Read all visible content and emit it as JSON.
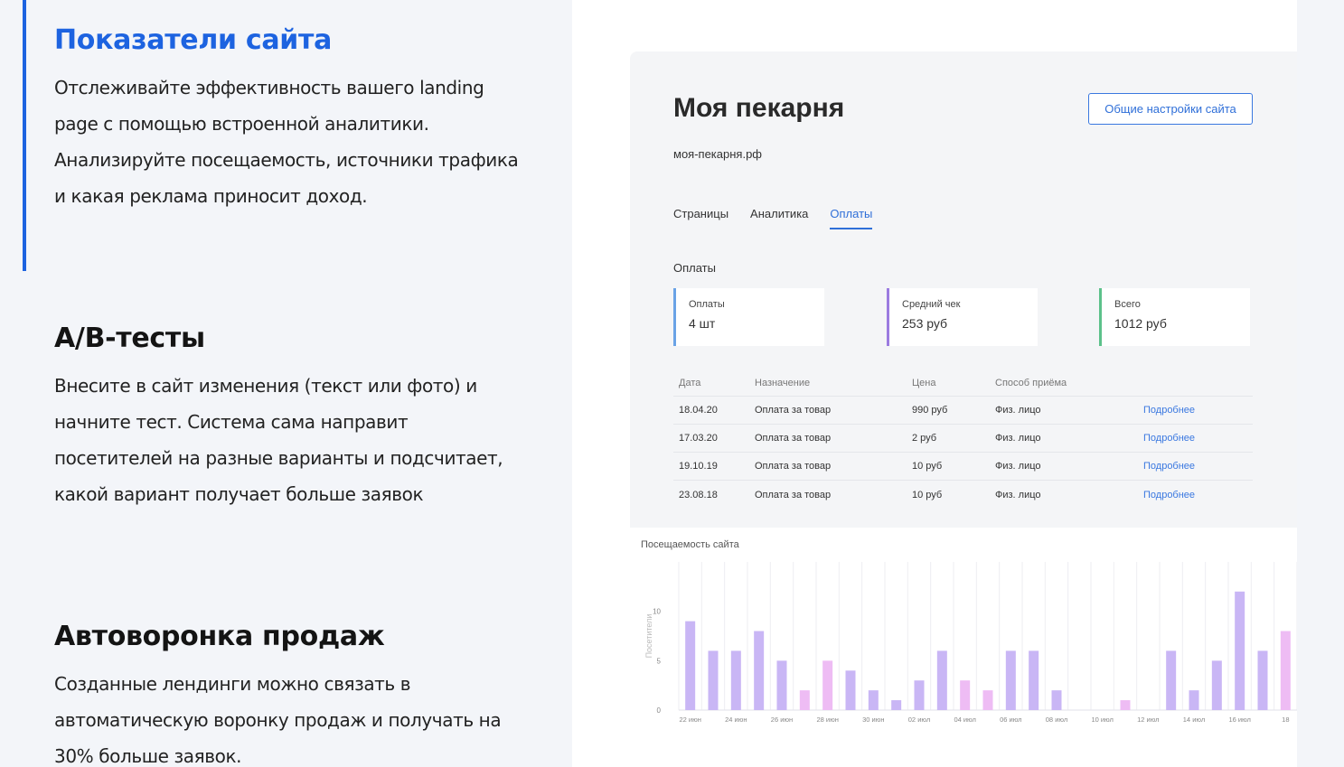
{
  "features": [
    {
      "title": "Показатели сайта",
      "text": "Отслеживайте эффективность вашего landing page с помощью встроенной аналитики. Анализируйте посещаемость, источники трафика и какая реклама приносит доход."
    },
    {
      "title": "A/B-тесты",
      "text": "Внесите в сайт изменения (текст или фото) и начните тест. Система сама направит посетителей на разные варианты и подсчитает, какой вариант получает больше заявок"
    },
    {
      "title": "Автоворонка продаж",
      "text": "Созданные лендинги можно связать в автоматическую воронку продаж и получать на 30% больше заявок."
    }
  ],
  "dashboard": {
    "site_title": "Моя пекарня",
    "site_url": "моя-пекарня.рф",
    "settings_button": "Общие настройки сайта",
    "tabs": [
      {
        "label": "Страницы",
        "active": false
      },
      {
        "label": "Аналитика",
        "active": false
      },
      {
        "label": "Оплаты",
        "active": true
      }
    ],
    "section_label": "Оплаты",
    "cards": [
      {
        "key": "Оплаты",
        "value": "4 шт"
      },
      {
        "key": "Средний чек",
        "value": "253 руб"
      },
      {
        "key": "Всего",
        "value": "1012 руб"
      }
    ],
    "table": {
      "headers": [
        "Дата",
        "Назначение",
        "Цена",
        "Способ приёма",
        ""
      ],
      "rows": [
        [
          "18.04.20",
          "Оплата за товар",
          "990 руб",
          "Физ. лицо",
          "Подробнее"
        ],
        [
          "17.03.20",
          "Оплата за товар",
          "2 руб",
          "Физ. лицо",
          "Подробнее"
        ],
        [
          "19.10.19",
          "Оплата за товар",
          "10 руб",
          "Физ. лицо",
          "Подробнее"
        ],
        [
          "23.08.18",
          "Оплата за товар",
          "10 руб",
          "Физ. лицо",
          "Подробнее"
        ]
      ]
    }
  },
  "colors": {
    "accent": "#1d63e0",
    "bar_purple": "#c9b6f5",
    "bar_pink": "#eebcf4"
  },
  "chart_data": {
    "type": "bar",
    "title": "Посещаемость сайта",
    "ylabel": "Посетители",
    "ylim": [
      0,
      15
    ],
    "yticks": [
      0,
      5,
      10
    ],
    "xticks": [
      "22 июн",
      "24 июн",
      "26 июн",
      "28 июн",
      "30 июн",
      "02 июл",
      "04 июл",
      "06 июл",
      "08 июл",
      "10 июл",
      "12 июл",
      "14 июл",
      "16 июл",
      "18"
    ],
    "values": [
      9,
      6,
      6,
      8,
      5,
      2,
      5,
      4,
      2,
      1,
      3,
      6,
      3,
      2,
      6,
      6,
      2,
      0,
      0,
      1,
      0,
      6,
      2,
      5,
      12,
      6,
      8
    ],
    "highlight": [
      false,
      false,
      false,
      false,
      false,
      true,
      true,
      false,
      false,
      false,
      false,
      false,
      true,
      true,
      false,
      false,
      false,
      false,
      false,
      true,
      false,
      false,
      false,
      false,
      false,
      false,
      true
    ]
  }
}
